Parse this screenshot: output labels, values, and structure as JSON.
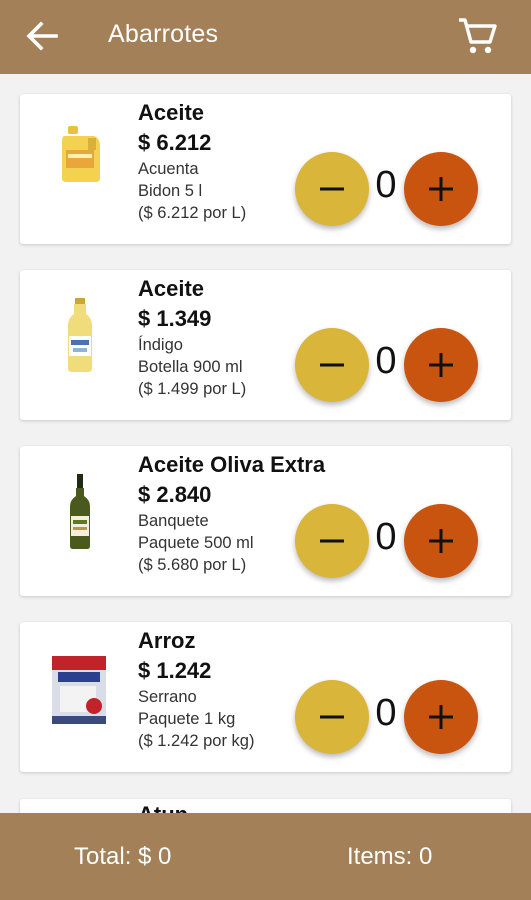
{
  "appbar": {
    "title": "Abarrotes",
    "back_icon": "arrow-left-icon",
    "cart_icon": "shopping-cart-icon"
  },
  "products": [
    {
      "name": "Aceite",
      "price": "$ 6.212",
      "brand": "Acuenta",
      "package": "Bidon 5 l",
      "unit_price": "($ 6.212 por L)",
      "quantity": "0"
    },
    {
      "name": "Aceite",
      "price": "$ 1.349",
      "brand": "Índigo",
      "package": "Botella 900 ml",
      "unit_price": "($ 1.499 por L)",
      "quantity": "0"
    },
    {
      "name": "Aceite Oliva Extra",
      "price": "$ 2.840",
      "brand": "Banquete",
      "package": "Paquete 500 ml",
      "unit_price": "($ 5.680 por L)",
      "quantity": "0"
    },
    {
      "name": "Arroz",
      "price": "$ 1.242",
      "brand": "Serrano",
      "package": "Paquete 1 kg",
      "unit_price": "($ 1.242 por kg)",
      "quantity": "0"
    }
  ],
  "partial_item": {
    "name": "Atun"
  },
  "footer": {
    "total": "Total: $ 0",
    "items": "Items: 0"
  },
  "colors": {
    "bar": "#a38057",
    "minus_button": "#d9b53a",
    "plus_button": "#c9540f",
    "background": "#f2f2f2"
  }
}
